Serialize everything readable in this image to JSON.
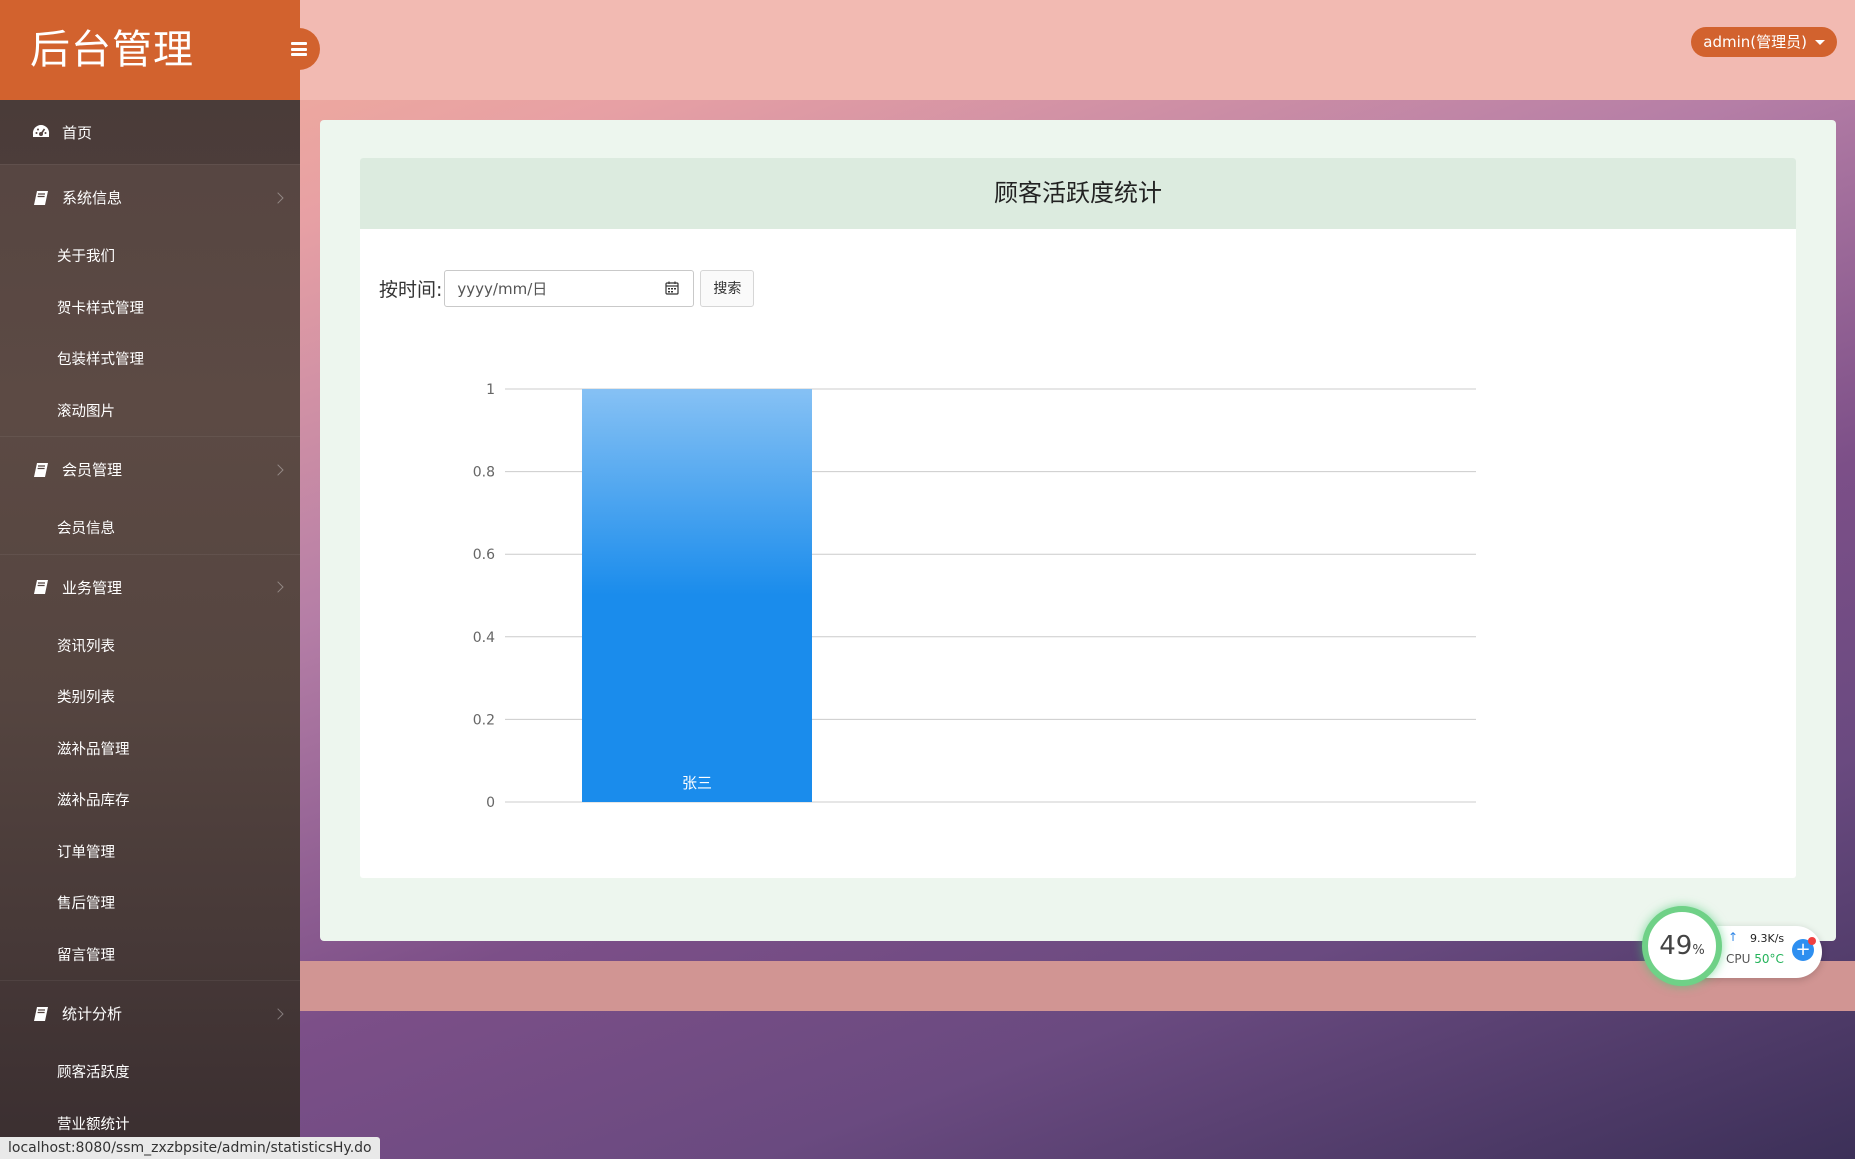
{
  "app": {
    "brand": "后台管理"
  },
  "sidebar": {
    "home": "首页",
    "groups": [
      {
        "label": "系统信息",
        "items": [
          "关于我们",
          "贺卡样式管理",
          "包装样式管理",
          "滚动图片"
        ]
      },
      {
        "label": "会员管理",
        "items": [
          "会员信息"
        ]
      },
      {
        "label": "业务管理",
        "items": [
          "资讯列表",
          "类别列表",
          "滋补品管理",
          "滋补品库存",
          "订单管理",
          "售后管理",
          "留言管理"
        ]
      },
      {
        "label": "统计分析",
        "items": [
          "顾客活跃度",
          "营业额统计"
        ]
      }
    ]
  },
  "header": {
    "user": "admin(管理员)"
  },
  "page": {
    "title": "顾客活跃度统计",
    "filter_label": "按时间:",
    "date_placeholder": "yyyy/mm/日",
    "search_label": "搜索"
  },
  "chart_data": {
    "type": "bar",
    "title": "",
    "categories": [
      "张三"
    ],
    "values": [
      1
    ],
    "ylim": [
      0,
      1
    ],
    "yticks": [
      "1",
      "0.8",
      "0.6",
      "0.4",
      "0.2",
      "0"
    ],
    "grid": true,
    "bar_color_top": "#86c1f4",
    "bar_color_bottom": "#1a8cec"
  },
  "status_bar": {
    "url": "localhost:8080/ssm_zxzbpsite/admin/statisticsHy.do"
  },
  "widget": {
    "cpu_percent": "49",
    "percent_sign": "%",
    "net_speed": "9.3K/s",
    "cpu_label": "CPU",
    "cpu_temp": "50°C"
  },
  "colors": {
    "accent": "#d2622e",
    "topbar": "#f2bab2",
    "sidebar": "#554540"
  }
}
